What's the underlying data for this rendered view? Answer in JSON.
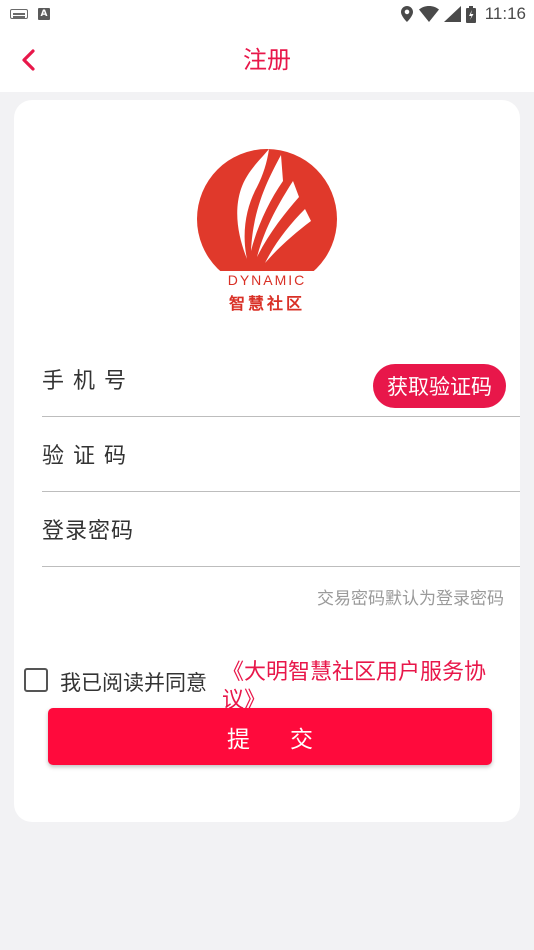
{
  "status_bar": {
    "time": "11:16",
    "left_icons": [
      "keyboard-icon",
      "a-icon"
    ],
    "a_icon_letter": "A",
    "right_icons": [
      "location-icon",
      "wifi-icon",
      "signal-icon",
      "battery-icon"
    ]
  },
  "nav": {
    "back_icon": "chevron-left-icon",
    "title": "注册"
  },
  "logo": {
    "text_en": "DYNAMIC",
    "text_cn": "智慧社区"
  },
  "form": {
    "phone_label": "手 机 号",
    "get_code_label": "获取验证码",
    "code_label": "验 证 码",
    "password_label": "登录密码",
    "hint": "交易密码默认为登录密码"
  },
  "agreement": {
    "checked": false,
    "text": "我已阅读并同意",
    "link_line1": "《大明智慧社区用户服务协",
    "link_line2": "议》"
  },
  "submit": {
    "label": "提交"
  },
  "colors": {
    "accent": "#e8174a",
    "button": "#ff0a3c",
    "logo": "#e0392b"
  }
}
